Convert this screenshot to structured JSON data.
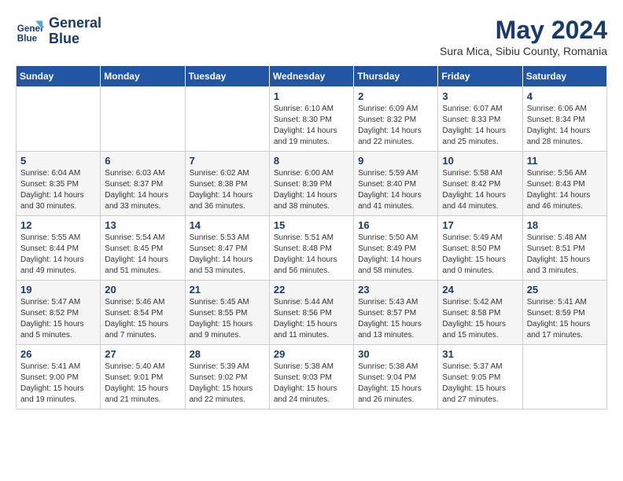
{
  "header": {
    "logo_line1": "General",
    "logo_line2": "Blue",
    "month_year": "May 2024",
    "location": "Sura Mica, Sibiu County, Romania"
  },
  "days_of_week": [
    "Sunday",
    "Monday",
    "Tuesday",
    "Wednesday",
    "Thursday",
    "Friday",
    "Saturday"
  ],
  "weeks": [
    [
      {
        "day": "",
        "content": ""
      },
      {
        "day": "",
        "content": ""
      },
      {
        "day": "",
        "content": ""
      },
      {
        "day": "1",
        "content": "Sunrise: 6:10 AM\nSunset: 8:30 PM\nDaylight: 14 hours\nand 19 minutes."
      },
      {
        "day": "2",
        "content": "Sunrise: 6:09 AM\nSunset: 8:32 PM\nDaylight: 14 hours\nand 22 minutes."
      },
      {
        "day": "3",
        "content": "Sunrise: 6:07 AM\nSunset: 8:33 PM\nDaylight: 14 hours\nand 25 minutes."
      },
      {
        "day": "4",
        "content": "Sunrise: 6:06 AM\nSunset: 8:34 PM\nDaylight: 14 hours\nand 28 minutes."
      }
    ],
    [
      {
        "day": "5",
        "content": "Sunrise: 6:04 AM\nSunset: 8:35 PM\nDaylight: 14 hours\nand 30 minutes."
      },
      {
        "day": "6",
        "content": "Sunrise: 6:03 AM\nSunset: 8:37 PM\nDaylight: 14 hours\nand 33 minutes."
      },
      {
        "day": "7",
        "content": "Sunrise: 6:02 AM\nSunset: 8:38 PM\nDaylight: 14 hours\nand 36 minutes."
      },
      {
        "day": "8",
        "content": "Sunrise: 6:00 AM\nSunset: 8:39 PM\nDaylight: 14 hours\nand 38 minutes."
      },
      {
        "day": "9",
        "content": "Sunrise: 5:59 AM\nSunset: 8:40 PM\nDaylight: 14 hours\nand 41 minutes."
      },
      {
        "day": "10",
        "content": "Sunrise: 5:58 AM\nSunset: 8:42 PM\nDaylight: 14 hours\nand 44 minutes."
      },
      {
        "day": "11",
        "content": "Sunrise: 5:56 AM\nSunset: 8:43 PM\nDaylight: 14 hours\nand 46 minutes."
      }
    ],
    [
      {
        "day": "12",
        "content": "Sunrise: 5:55 AM\nSunset: 8:44 PM\nDaylight: 14 hours\nand 49 minutes."
      },
      {
        "day": "13",
        "content": "Sunrise: 5:54 AM\nSunset: 8:45 PM\nDaylight: 14 hours\nand 51 minutes."
      },
      {
        "day": "14",
        "content": "Sunrise: 5:53 AM\nSunset: 8:47 PM\nDaylight: 14 hours\nand 53 minutes."
      },
      {
        "day": "15",
        "content": "Sunrise: 5:51 AM\nSunset: 8:48 PM\nDaylight: 14 hours\nand 56 minutes."
      },
      {
        "day": "16",
        "content": "Sunrise: 5:50 AM\nSunset: 8:49 PM\nDaylight: 14 hours\nand 58 minutes."
      },
      {
        "day": "17",
        "content": "Sunrise: 5:49 AM\nSunset: 8:50 PM\nDaylight: 15 hours\nand 0 minutes."
      },
      {
        "day": "18",
        "content": "Sunrise: 5:48 AM\nSunset: 8:51 PM\nDaylight: 15 hours\nand 3 minutes."
      }
    ],
    [
      {
        "day": "19",
        "content": "Sunrise: 5:47 AM\nSunset: 8:52 PM\nDaylight: 15 hours\nand 5 minutes."
      },
      {
        "day": "20",
        "content": "Sunrise: 5:46 AM\nSunset: 8:54 PM\nDaylight: 15 hours\nand 7 minutes."
      },
      {
        "day": "21",
        "content": "Sunrise: 5:45 AM\nSunset: 8:55 PM\nDaylight: 15 hours\nand 9 minutes."
      },
      {
        "day": "22",
        "content": "Sunrise: 5:44 AM\nSunset: 8:56 PM\nDaylight: 15 hours\nand 11 minutes."
      },
      {
        "day": "23",
        "content": "Sunrise: 5:43 AM\nSunset: 8:57 PM\nDaylight: 15 hours\nand 13 minutes."
      },
      {
        "day": "24",
        "content": "Sunrise: 5:42 AM\nSunset: 8:58 PM\nDaylight: 15 hours\nand 15 minutes."
      },
      {
        "day": "25",
        "content": "Sunrise: 5:41 AM\nSunset: 8:59 PM\nDaylight: 15 hours\nand 17 minutes."
      }
    ],
    [
      {
        "day": "26",
        "content": "Sunrise: 5:41 AM\nSunset: 9:00 PM\nDaylight: 15 hours\nand 19 minutes."
      },
      {
        "day": "27",
        "content": "Sunrise: 5:40 AM\nSunset: 9:01 PM\nDaylight: 15 hours\nand 21 minutes."
      },
      {
        "day": "28",
        "content": "Sunrise: 5:39 AM\nSunset: 9:02 PM\nDaylight: 15 hours\nand 22 minutes."
      },
      {
        "day": "29",
        "content": "Sunrise: 5:38 AM\nSunset: 9:03 PM\nDaylight: 15 hours\nand 24 minutes."
      },
      {
        "day": "30",
        "content": "Sunrise: 5:38 AM\nSunset: 9:04 PM\nDaylight: 15 hours\nand 26 minutes."
      },
      {
        "day": "31",
        "content": "Sunrise: 5:37 AM\nSunset: 9:05 PM\nDaylight: 15 hours\nand 27 minutes."
      },
      {
        "day": "",
        "content": ""
      }
    ]
  ]
}
